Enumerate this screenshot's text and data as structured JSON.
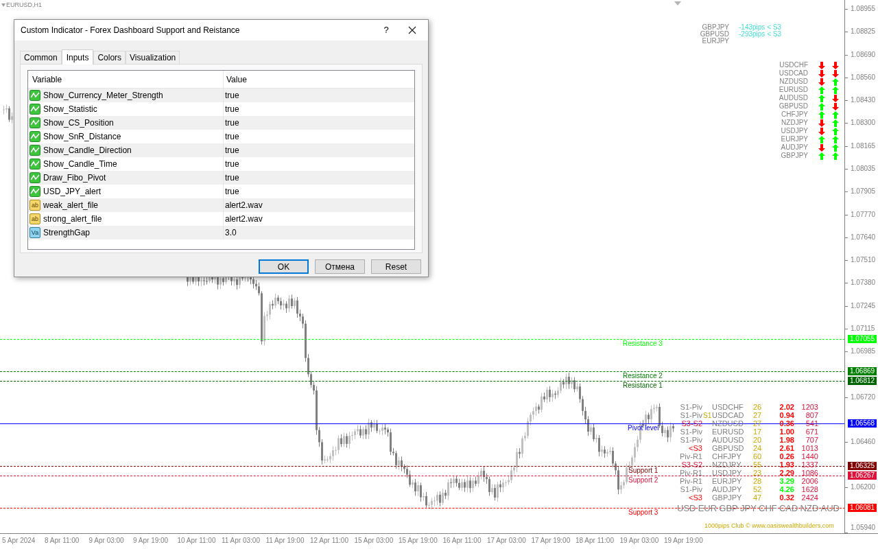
{
  "chart": {
    "symbol": "EURUSD,H1",
    "marker": "S1"
  },
  "dialog": {
    "title": "Custom Indicator - Forex Dashboard Support and Reistance",
    "help": "?",
    "tabs": [
      {
        "label": "Common",
        "selected": false
      },
      {
        "label": "Inputs",
        "selected": true
      },
      {
        "label": "Colors",
        "selected": false
      },
      {
        "label": "Visualization",
        "selected": false
      }
    ],
    "columns": [
      "Variable",
      "Value"
    ],
    "rows": [
      {
        "kind": "bool",
        "variable": "Show_Currency_Meter_Strength",
        "value": "true"
      },
      {
        "kind": "bool",
        "variable": "Show_Statistic",
        "value": "true"
      },
      {
        "kind": "bool",
        "variable": "Show_CS_Position",
        "value": "true"
      },
      {
        "kind": "bool",
        "variable": "Show_SnR_Distance",
        "value": "true"
      },
      {
        "kind": "bool",
        "variable": "Show_Candle_Direction",
        "value": "true"
      },
      {
        "kind": "bool",
        "variable": "Show_Candle_Time",
        "value": "true"
      },
      {
        "kind": "bool",
        "variable": "Draw_Fibo_Pivot",
        "value": "true"
      },
      {
        "kind": "bool",
        "variable": "USD_JPY_alert",
        "value": "true"
      },
      {
        "kind": "string",
        "icon": "ab",
        "variable": "weak_alert_file",
        "value": "alert2.wav"
      },
      {
        "kind": "string",
        "icon": "ab",
        "variable": "strong_alert_file",
        "value": "alert2.wav"
      },
      {
        "kind": "number",
        "icon": "Va",
        "variable": "StrengthGap",
        "value": "3.0"
      }
    ],
    "buttons": [
      {
        "label": "OK",
        "default": true
      },
      {
        "label": "Отмена",
        "default": false
      },
      {
        "label": "Reset",
        "default": false
      }
    ]
  },
  "price_axis": [
    "1.08955",
    "1.08825",
    "1.08690",
    "1.08560",
    "1.08430",
    "1.08300",
    "1.08165",
    "1.08035",
    "1.07905",
    "1.07770",
    "1.07640",
    "1.07510",
    "1.07380",
    "1.07245",
    "1.07115",
    "1.06985",
    "1.06720",
    "1.06460",
    "1.06200",
    "1.05940"
  ],
  "time_axis": [
    "5 Apr 2024",
    "8 Apr 11:00",
    "9 Apr 03:00",
    "9 Apr 19:00",
    "10 Apr 11:00",
    "11 Apr 03:00",
    "11 Apr 19:00",
    "12 Apr 11:00",
    "15 Apr 03:00",
    "15 Apr 19:00",
    "16 Apr 11:00",
    "17 Apr 03:00",
    "17 Apr 19:00",
    "18 Apr 11:00",
    "19 Apr 03:00",
    "19 Apr 19:00"
  ],
  "levels": [
    {
      "label": "Resistance 3",
      "price": "1.07055",
      "color": "#00ff00",
      "kind": "dashed"
    },
    {
      "label": "Resistance 2",
      "price": "1.06869",
      "color": "#008000",
      "kind": "dashed"
    },
    {
      "label": "Resistance 1",
      "price": "1.06812",
      "color": "#006400",
      "kind": "dashed"
    },
    {
      "label": "Pivot level",
      "price": "1.06568",
      "color": "#0000ff",
      "kind": "solid"
    },
    {
      "label": "Support 1",
      "price": "1.06325",
      "color": "#800000",
      "kind": "dashed"
    },
    {
      "label": "Support 2",
      "price": "1.06267",
      "color": "#dc143c",
      "kind": "dashed"
    },
    {
      "label": "Support 3",
      "price": "1.06081",
      "color": "#ff0000",
      "kind": "dashed"
    }
  ],
  "distances": [
    {
      "pair": "GBPJPY",
      "distance": "-143pips < S3"
    },
    {
      "pair": "GBPUSD",
      "distance": "-293pips < S3"
    },
    {
      "pair": "EURJPY"
    }
  ],
  "directions": [
    {
      "pair": "USDCHF",
      "first_up": false,
      "second_up": false
    },
    {
      "pair": "USDCAD",
      "first_up": false,
      "second_up": false
    },
    {
      "pair": "NZDUSD",
      "first_up": false,
      "second_up": true
    },
    {
      "pair": "EURUSD",
      "first_up": true,
      "second_up": true
    },
    {
      "pair": "AUDUSD",
      "first_up": true,
      "second_up": false
    },
    {
      "pair": "GBPUSD",
      "first_up": true,
      "second_up": false
    },
    {
      "pair": "CHFJPY",
      "first_up": true,
      "second_up": true
    },
    {
      "pair": "NZDJPY",
      "first_up": false,
      "second_up": true
    },
    {
      "pair": "USDJPY",
      "first_up": false,
      "second_up": true
    },
    {
      "pair": "EURJPY",
      "first_up": true,
      "second_up": true
    },
    {
      "pair": "AUDJPY",
      "first_up": false,
      "second_up": true
    },
    {
      "pair": "GBPJPY",
      "first_up": true,
      "second_up": true
    }
  ],
  "statistics": [
    {
      "zone": {
        "text": "S1-Piv",
        "color": "#808080"
      },
      "pair": "USDCHF",
      "strength": "26",
      "change": {
        "text": "2.02",
        "color": "#ff0000"
      },
      "pips": "1203"
    },
    {
      "zone": {
        "text": "S1-Piv",
        "color": "#808080"
      },
      "pair": "USDCAD",
      "strength": "27",
      "change": {
        "text": "0.94",
        "color": "#ff0000"
      },
      "pips": "807"
    },
    {
      "zone": {
        "text": "S3-S2",
        "color": "#dc143c"
      },
      "pair": "NZDUSD",
      "strength": "27",
      "change": {
        "text": "0.36",
        "color": "#ff0000"
      },
      "pips": "541"
    },
    {
      "zone": {
        "text": "S1-Piv",
        "color": "#808080"
      },
      "pair": "EURUSD",
      "strength": "17",
      "change": {
        "text": "1.00",
        "color": "#ff0000"
      },
      "pips": "671"
    },
    {
      "zone": {
        "text": "S1-Piv",
        "color": "#808080"
      },
      "pair": "AUDUSD",
      "strength": "20",
      "change": {
        "text": "1.98",
        "color": "#ff0000"
      },
      "pips": "707"
    },
    {
      "zone": {
        "text": "<S3",
        "color": "#ff0000"
      },
      "pair": "GBPUSD",
      "strength": "24",
      "change": {
        "text": "2.61",
        "color": "#ff0000"
      },
      "pips": "1013"
    },
    {
      "zone": {
        "text": "Piv-R1",
        "color": "#808080"
      },
      "pair": "CHFJPY",
      "strength": "60",
      "change": {
        "text": "0.26",
        "color": "#ff0000"
      },
      "pips": "1440"
    },
    {
      "zone": {
        "text": "S3-S2",
        "color": "#dc143c"
      },
      "pair": "NZDJPY",
      "strength": "55",
      "change": {
        "text": "1.93",
        "color": "#ff0000"
      },
      "pips": "1337"
    },
    {
      "zone": {
        "text": "Piv-R1",
        "color": "#808080"
      },
      "pair": "USDJPY",
      "strength": "23",
      "change": {
        "text": "2.29",
        "color": "#ff0000"
      },
      "pips": "1086"
    },
    {
      "zone": {
        "text": "Piv-R1",
        "color": "#808080"
      },
      "pair": "EURJPY",
      "strength": "28",
      "change": {
        "text": "3.29",
        "color": "#00ff00"
      },
      "pips": "2006"
    },
    {
      "zone": {
        "text": "S1-Piv",
        "color": "#808080"
      },
      "pair": "AUDJPY",
      "strength": "52",
      "change": {
        "text": "4.26",
        "color": "#00ff00"
      },
      "pips": "1628"
    },
    {
      "zone": {
        "text": "<S3",
        "color": "#ff0000"
      },
      "pair": "GBPJPY",
      "strength": "47",
      "change": {
        "text": "0.32",
        "color": "#ff0000"
      },
      "pips": "2424"
    }
  ],
  "currencies": [
    "USD",
    "EUR",
    "GBP",
    "JPY",
    "CHF",
    "CAD",
    "NZD",
    "AUD"
  ],
  "footer": "1000pips Club © www.oasiswealthbuilders.com"
}
